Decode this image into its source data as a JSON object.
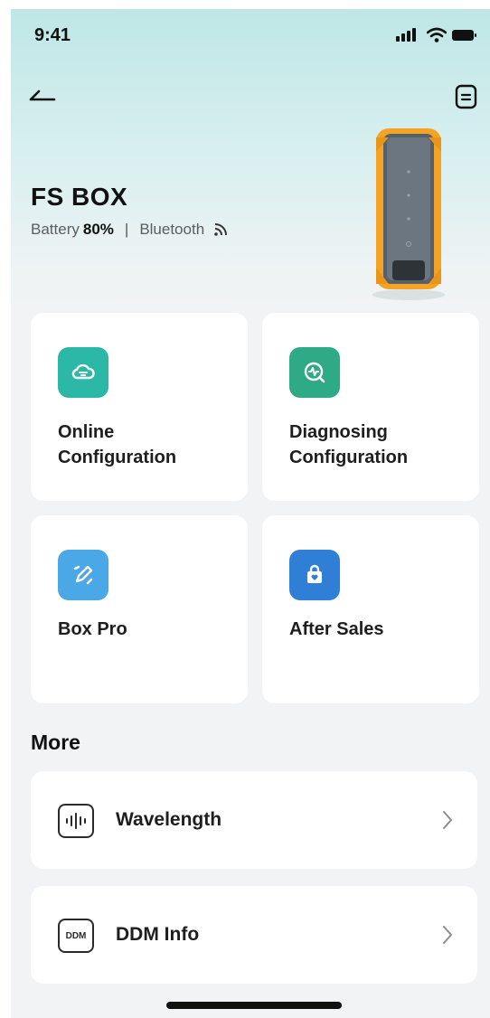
{
  "status_bar": {
    "time": "9:41"
  },
  "device": {
    "name": "FS BOX",
    "battery_label": "Battery",
    "battery_value": "80%",
    "separator": "|",
    "connection": "Bluetooth"
  },
  "cards": [
    {
      "label": "Online\nConfiguration",
      "icon": "cloud-config-icon",
      "color": "#2bb8a6"
    },
    {
      "label": "Diagnosing\nConfiguration",
      "icon": "diagnose-icon",
      "color": "#2faa86"
    },
    {
      "label": "Box Pro",
      "icon": "edit-tool-icon",
      "color": "#4aa8e6"
    },
    {
      "label": "After Sales",
      "icon": "after-sales-bag-icon",
      "color": "#2f7fd6"
    }
  ],
  "more": {
    "title": "More",
    "items": [
      {
        "label": "Wavelength",
        "icon": "wavelength-icon"
      },
      {
        "label": "DDM Info",
        "icon": "ddm-icon",
        "icon_text": "DDM"
      }
    ]
  }
}
